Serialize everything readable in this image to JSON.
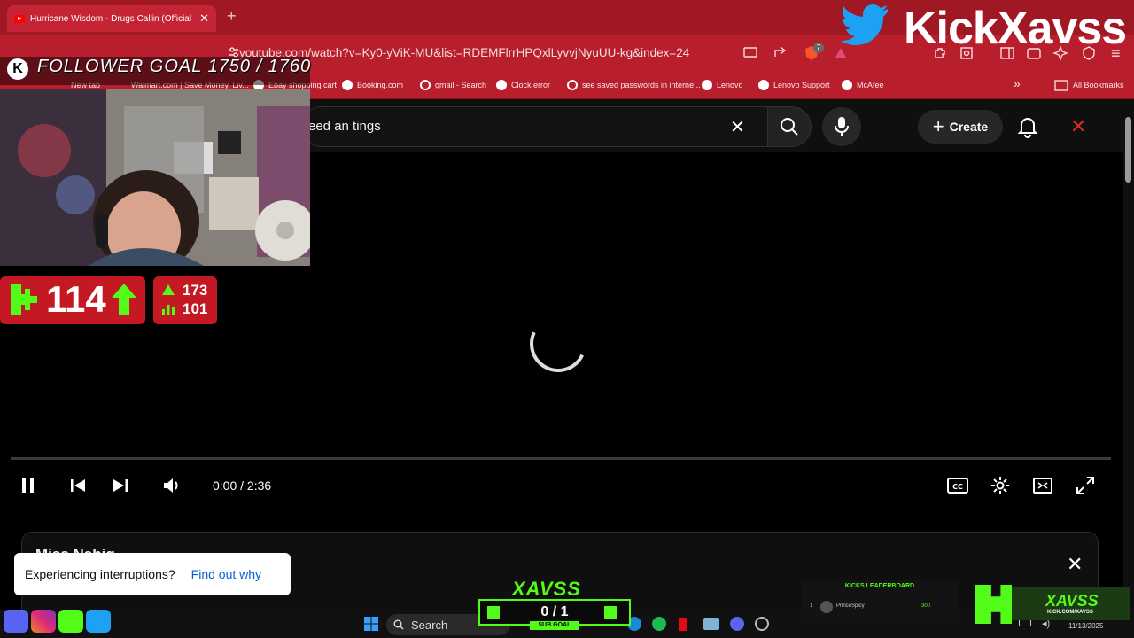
{
  "browser": {
    "tab_title": "Hurricane Wisdom - Drugs Callin (Official M",
    "new_tab": "+",
    "url": "youtube.com/watch?v=Ky0-yViK-MU&list=RDEMFlrrHPQxlLyvvjNyuUU-kg&index=24",
    "bookmarks": [
      {
        "label": "New tab"
      },
      {
        "label": "Walmart.com | Save Money. Liv..."
      },
      {
        "label": "Ebay shopping cart"
      },
      {
        "label": "Booking.com"
      },
      {
        "label": "gmail - Search"
      },
      {
        "label": "Clock error"
      },
      {
        "label": "see saved passwords in interne..."
      },
      {
        "label": "Lenovo"
      },
      {
        "label": "Lenovo Support"
      },
      {
        "label": "McAfee"
      }
    ],
    "all_bookmarks": "All Bookmarks",
    "shield_badge": "7"
  },
  "youtube": {
    "search_value": "eed an tings",
    "create_label": "Create",
    "player": {
      "time": "0:00 / 2:36",
      "progress": 0.0
    },
    "below_title": "Miss Nabiq",
    "toast": {
      "message": "Experiencing interruptions?",
      "link": "Find out why"
    }
  },
  "overlay": {
    "follower_goal": "FOLLOWER GOAL 1750 / 1760",
    "kick_count": "114",
    "stat_up": "173",
    "stat_bars": "101",
    "kick_brand": "KickXavss",
    "sub_goal_brand": "XAVSS",
    "sub_goal_count": "0 / 1",
    "sub_goal_label": "SUB GOAL",
    "leaderboard_title": "KICKS LEADERBOARD",
    "leaderboard_rank": "1",
    "leaderboard_user": "PrinceSpicy",
    "leaderboard_value": "300",
    "xavss_logo": "XAVSS",
    "xavss_url": "KICK.COM/XAVSS"
  },
  "taskbar": {
    "search_label": "Search",
    "date": "11/13/2025"
  },
  "colors": {
    "chrome_red": "#b91e2c",
    "kick_green": "#53fc18",
    "yt_red": "#ff0000"
  }
}
